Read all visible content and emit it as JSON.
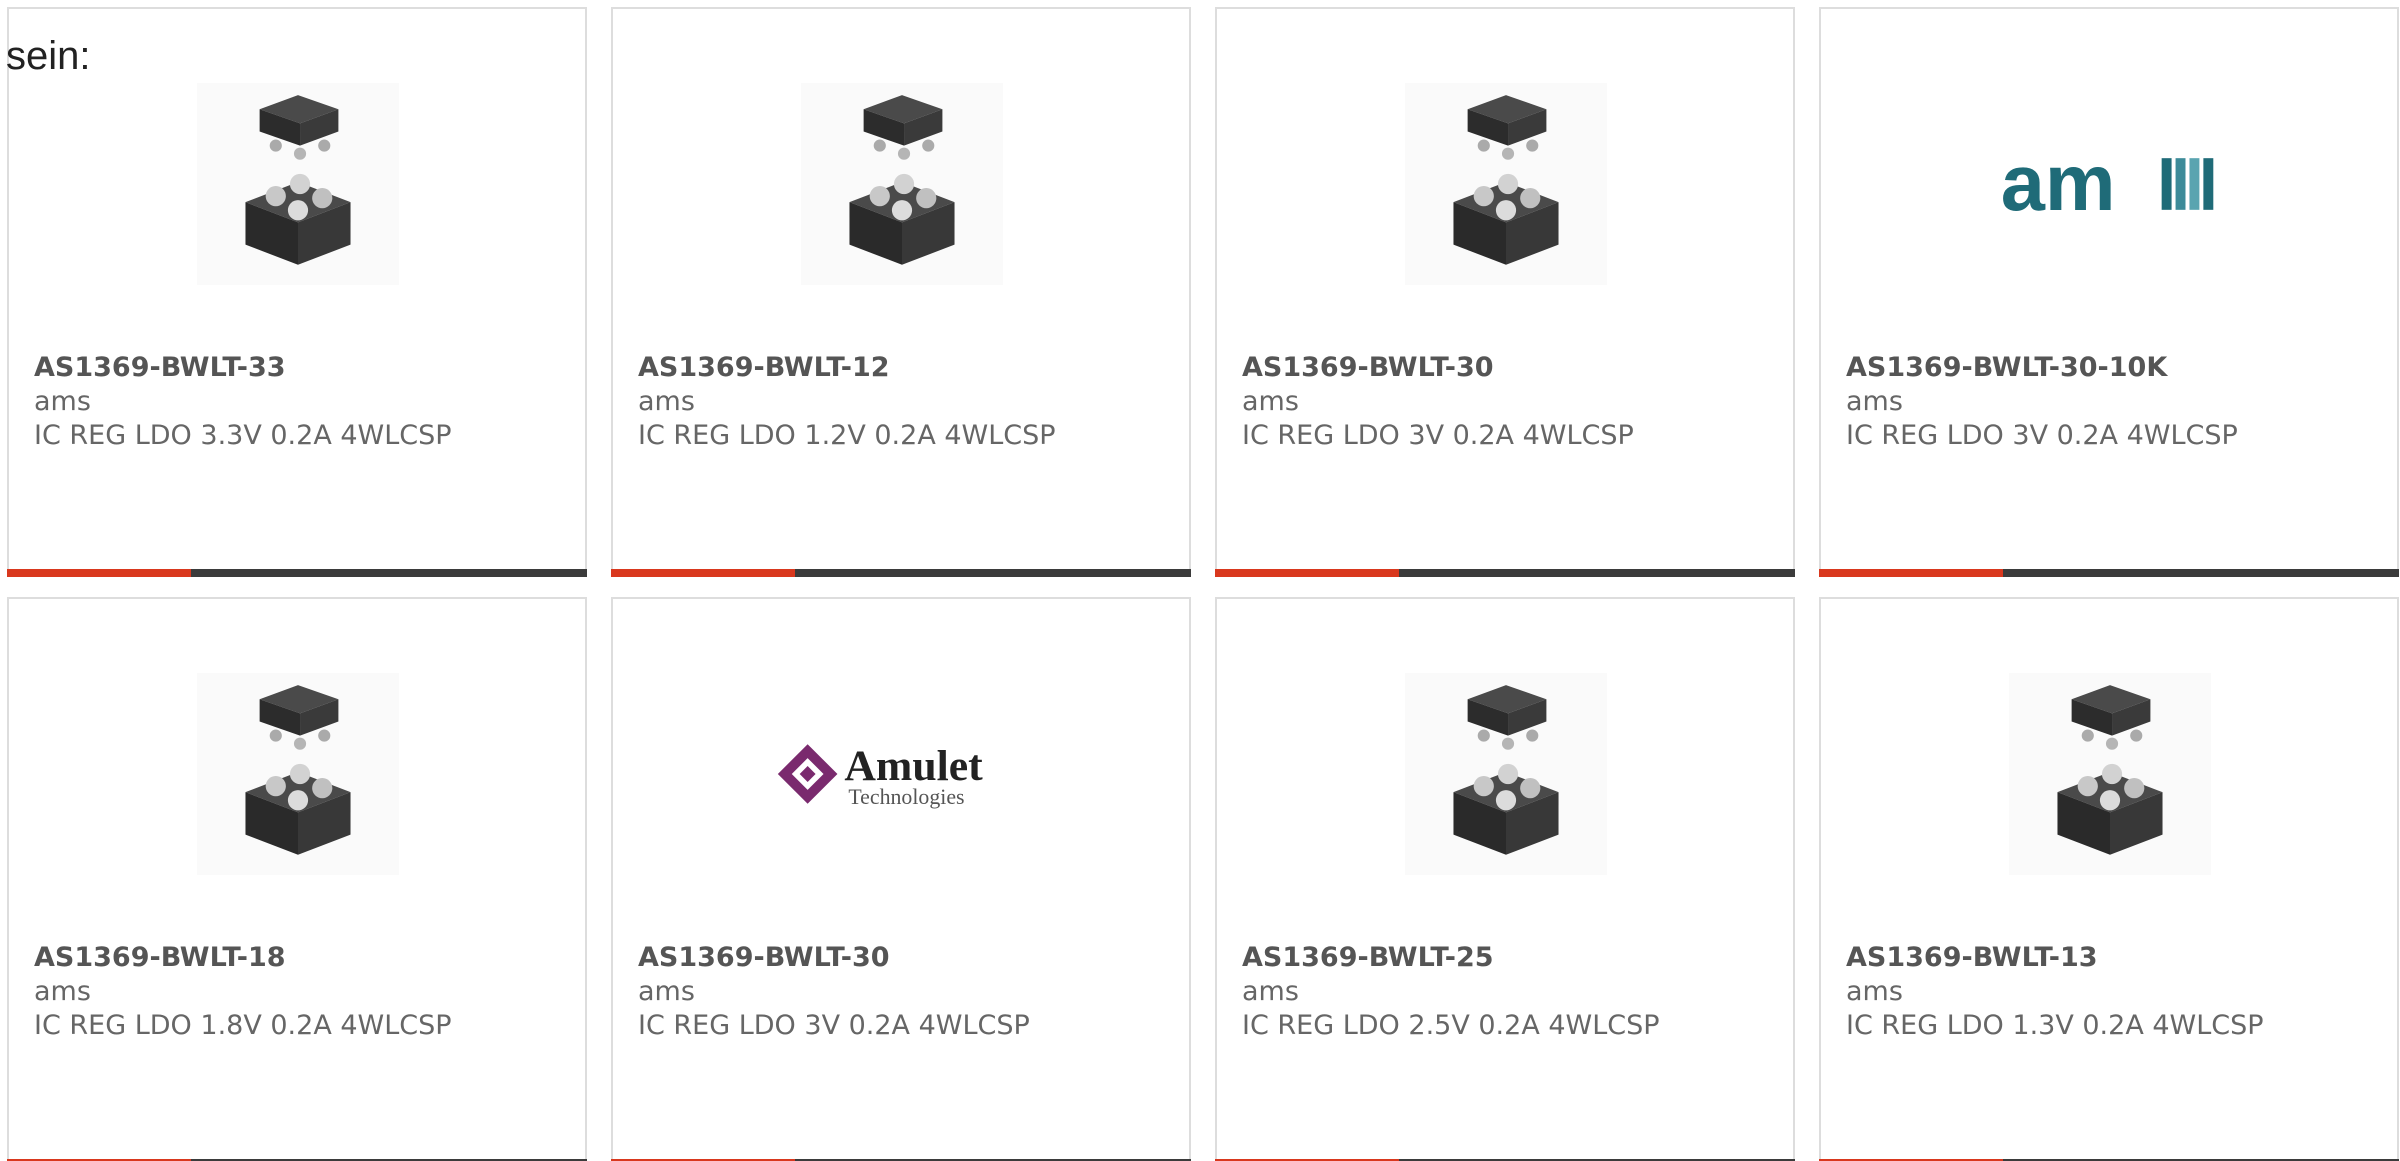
{
  "intro_text": "sein:",
  "colors": {
    "accent": "#d9381e",
    "bar_dark": "#3b3b3b",
    "text": "#666666",
    "border": "#dddddd"
  },
  "products": [
    {
      "part_number": "AS1369-BWLT-33",
      "manufacturer": "ams",
      "description": "IC REG LDO 3.3V 0.2A 4WLCSP",
      "image": "wlcsp-chip-image"
    },
    {
      "part_number": "AS1369-BWLT-12",
      "manufacturer": "ams",
      "description": "IC REG LDO 1.2V 0.2A 4WLCSP",
      "image": "wlcsp-chip-image"
    },
    {
      "part_number": "AS1369-BWLT-30",
      "manufacturer": "ams",
      "description": "IC REG LDO 3V 0.2A 4WLCSP",
      "image": "wlcsp-chip-image"
    },
    {
      "part_number": "AS1369-BWLT-30-10K",
      "manufacturer": "ams",
      "description": "IC REG LDO 3V 0.2A 4WLCSP",
      "image": "ams-logo"
    },
    {
      "part_number": "AS1369-BWLT-18",
      "manufacturer": "ams",
      "description": "IC REG LDO 1.8V 0.2A 4WLCSP",
      "image": "wlcsp-chip-image"
    },
    {
      "part_number": "AS1369-BWLT-30",
      "manufacturer": "ams",
      "description": "IC REG LDO 3V 0.2A 4WLCSP",
      "image": "amulet-technologies-logo"
    },
    {
      "part_number": "AS1369-BWLT-25",
      "manufacturer": "ams",
      "description": "IC REG LDO 2.5V 0.2A 4WLCSP",
      "image": "wlcsp-chip-image"
    },
    {
      "part_number": "AS1369-BWLT-13",
      "manufacturer": "ams",
      "description": "IC REG LDO 1.3V 0.2A 4WLCSP",
      "image": "wlcsp-chip-image"
    }
  ],
  "logos": {
    "ams": "am",
    "amulet_name": "Amulet",
    "amulet_sub": "Technologies"
  }
}
